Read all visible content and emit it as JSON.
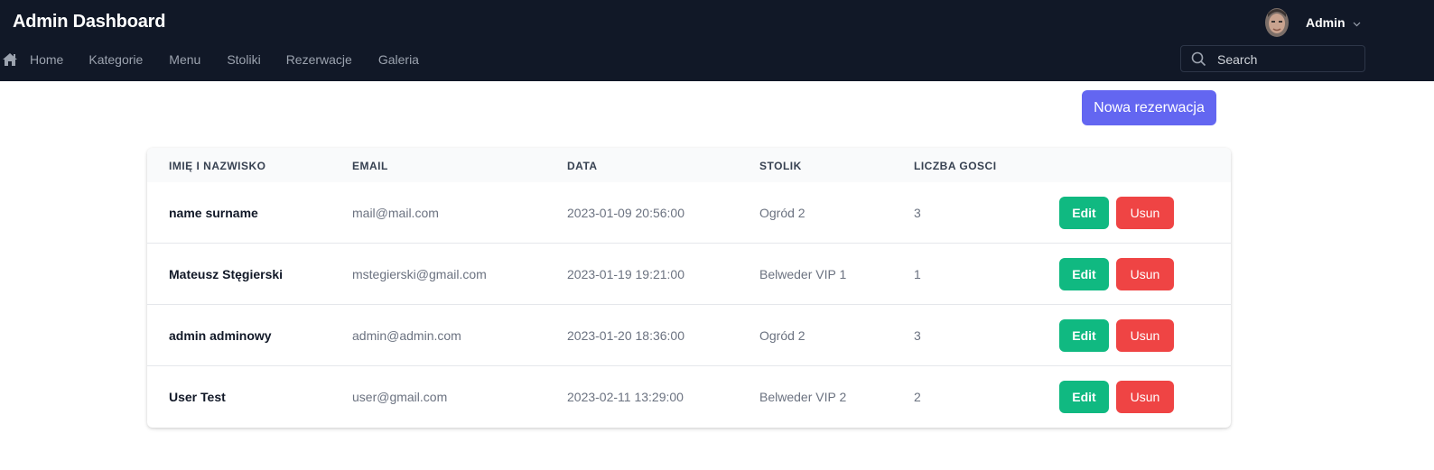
{
  "header": {
    "title": "Admin Dashboard",
    "user": {
      "name": "Admin",
      "avatar_icon": "user-avatar",
      "dropdown_icon": "chevron-down-icon"
    },
    "search": {
      "placeholder": "Search",
      "value": "",
      "icon": "search-icon"
    },
    "nav": [
      {
        "label": "Home",
        "icon": "home-icon"
      },
      {
        "label": "Kategorie"
      },
      {
        "label": "Menu"
      },
      {
        "label": "Stoliki"
      },
      {
        "label": "Rezerwacje"
      },
      {
        "label": "Galeria"
      }
    ]
  },
  "toolbar": {
    "new_reservation_label": "Nowa rezerwacja"
  },
  "table": {
    "columns": [
      "IMIĘ I NAZWISKO",
      "EMAIL",
      "DATA",
      "STOLIK",
      "LICZBA GOSCI"
    ],
    "rows": [
      {
        "name": "name surname",
        "email": "mail@mail.com",
        "date": "2023-01-09 20:56:00",
        "table": "Ogród 2",
        "guests": "3",
        "edit_label": "Edit",
        "delete_label": "Usun"
      },
      {
        "name": "Mateusz Stęgierski",
        "email": "mstegierski@gmail.com",
        "date": "2023-01-19 19:21:00",
        "table": "Belweder VIP 1",
        "guests": "1",
        "edit_label": "Edit",
        "delete_label": "Usun"
      },
      {
        "name": "admin adminowy",
        "email": "admin@admin.com",
        "date": "2023-01-20 18:36:00",
        "table": "Ogród 2",
        "guests": "3",
        "edit_label": "Edit",
        "delete_label": "Usun"
      },
      {
        "name": "User Test",
        "email": "user@gmail.com",
        "date": "2023-02-11 13:29:00",
        "table": "Belweder VIP 2",
        "guests": "2",
        "edit_label": "Edit",
        "delete_label": "Usun"
      }
    ]
  },
  "colors": {
    "header_bg": "#111827",
    "nav_text": "#9ca3af",
    "primary": "#6366f1",
    "edit": "#10b981",
    "delete": "#ef4444",
    "table_head_bg": "#f9fafb"
  }
}
